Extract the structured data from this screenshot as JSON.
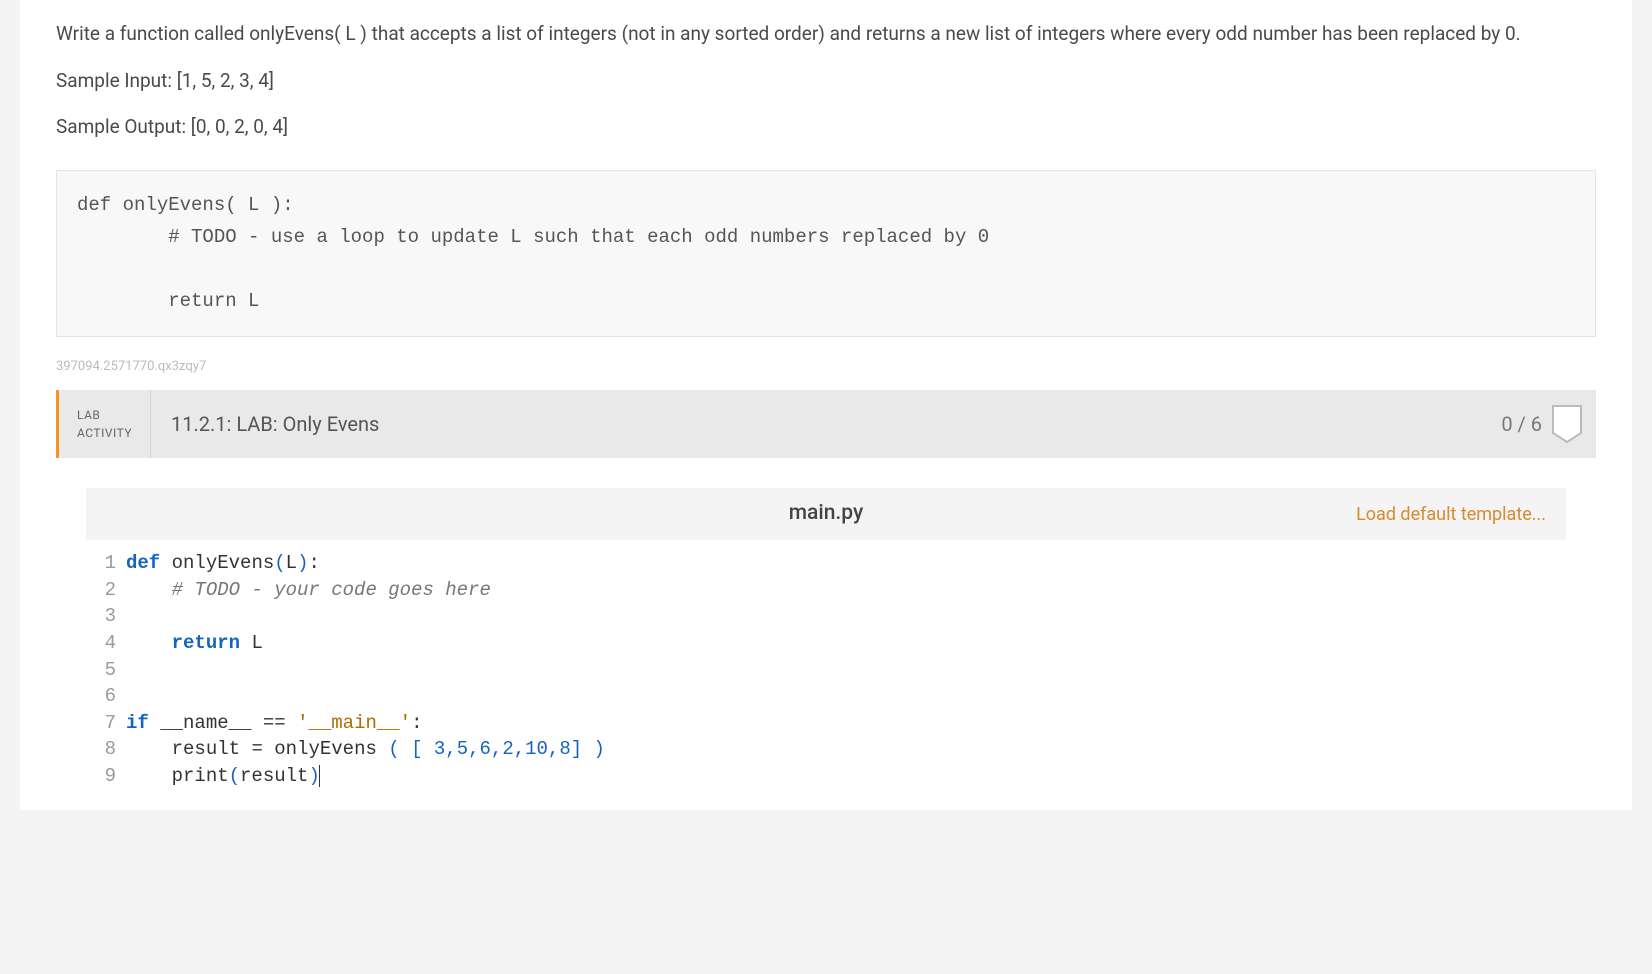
{
  "problem": {
    "p1": "Write a function called onlyEvens( L ) that accepts a list of integers (not in any sorted order) and returns a new list of integers where every odd number has been replaced by 0.",
    "p2": "Sample Input: [1, 5, 2, 3, 4]",
    "p3": "Sample Output: [0, 0, 2, 0, 4]"
  },
  "sample_code": "def onlyEvens( L ):\n        # TODO - use a loop to update L such that each odd numbers replaced by 0\n\n        return L",
  "identifier": "397094.2571770.qx3zqy7",
  "lab": {
    "label_line1": "LAB",
    "label_line2": "ACTIVITY",
    "title": "11.2.1: LAB: Only Evens",
    "score": "0 / 6"
  },
  "editor": {
    "filename": "main.py",
    "load_template": "Load default template...",
    "lines": {
      "l1": {
        "num": "1"
      },
      "l2": {
        "num": "2"
      },
      "l3": {
        "num": "3"
      },
      "l4": {
        "num": "4"
      },
      "l5": {
        "num": "5"
      },
      "l6": {
        "num": "6"
      },
      "l7": {
        "num": "7"
      },
      "l8": {
        "num": "8"
      },
      "l9": {
        "num": "9"
      }
    },
    "tokens": {
      "def": "def",
      "onlyEvens": "onlyEvens",
      "L": "L",
      "todo_comment": "# TODO - your code goes here",
      "return": "return",
      "if": "if",
      "name_dunder": "__name__",
      "eq": "==",
      "main_str": "'__main__'",
      "colon": ":",
      "result": "result",
      "assign": "=",
      "call_args": "3,5,6,2,10,8",
      "print": "print"
    }
  }
}
